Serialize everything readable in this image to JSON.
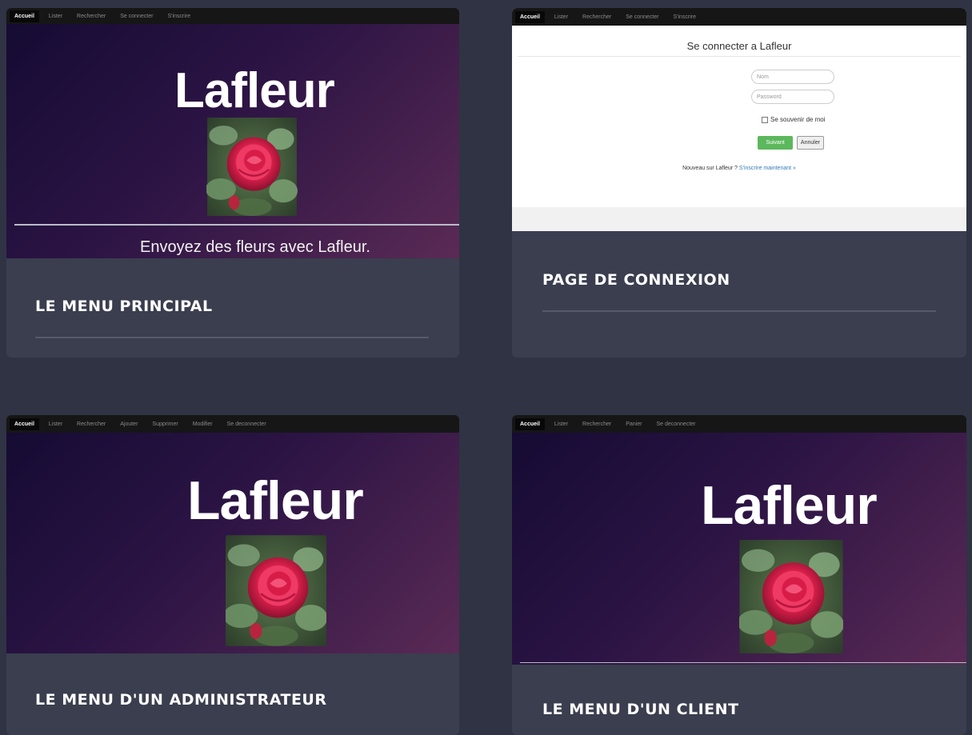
{
  "cards": {
    "main": {
      "nav": [
        "Accueil",
        "Lister",
        "Rechercher",
        "Se connecter",
        "S'inscrire"
      ],
      "brand": "Lafleur",
      "slogan": "Envoyez des fleurs avec Lafleur.",
      "caption": "LE MENU PRINCIPAL"
    },
    "login": {
      "nav": [
        "Accueil",
        "Lister",
        "Rechercher",
        "Se connecter",
        "S'inscrire"
      ],
      "title": "Se connecter a Lafleur",
      "name_placeholder": "Nom",
      "password_placeholder": "Password",
      "remember_label": "Se souvenir de moi",
      "submit_label": "Suivant",
      "cancel_label": "Annuler",
      "signup_text": "Nouveau sur Lafleur ?",
      "signup_link": "S'inscrire maintenant »",
      "caption": "PAGE DE CONNEXION"
    },
    "admin": {
      "nav": [
        "Accueil",
        "Lister",
        "Rechercher",
        "Ajouter",
        "Supprimer",
        "Modifier",
        "Se deconnecter"
      ],
      "brand": "Lafleur",
      "caption": "LE MENU D'UN ADMINISTRATEUR"
    },
    "client": {
      "nav": [
        "Accueil",
        "Lister",
        "Rechercher",
        "Panier",
        "Se deconnecter"
      ],
      "brand": "Lafleur",
      "caption": "LE MENU D'UN CLIENT"
    }
  },
  "colors": {
    "page_bg": "#2f3343",
    "card_bg": "#3a3e4e",
    "hero_dark": "#150b33",
    "hero_light": "#5a2a55",
    "success_button": "#5cb85c",
    "link": "#337ab7"
  }
}
